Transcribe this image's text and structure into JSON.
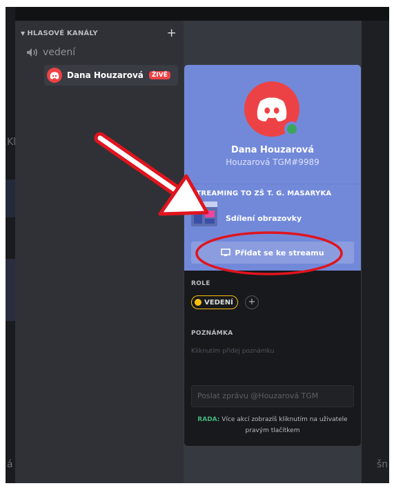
{
  "sidebar": {
    "category": "HLASOVÉ KANÁLY",
    "add_symbol": "+",
    "voice_channel": "vedení",
    "voice_user": {
      "name": "Dana Houzarová",
      "live_badge": "ŽIVĚ"
    }
  },
  "popout": {
    "name": "Dana Houzarová",
    "tag": "Houzarová TGM#9989",
    "stream_title": "STREAMING TO ZŠ T. G. MASARYKA",
    "stream_label": "Sdílení obrazovky",
    "join_button": "Přidat se ke streamu",
    "roles_title": "ROLE",
    "role": "VEDENÍ",
    "role_add": "+",
    "note_title": "POZNÁMKA",
    "note_placeholder": "Kliknutím přidej poznámku",
    "message_placeholder": "Poslat zprávu @Houzarová TGM",
    "tip_key": "RADA:",
    "tip_text": "Více akcí zobrazíš kliknutím na uživatele pravým tlačítkem"
  },
  "edge_texts": [
    "Kl",
    "á",
    "šn"
  ],
  "colors": {
    "blurple": "#7289da",
    "danger": "#ed4245",
    "online": "#3ba55c",
    "role": "#fcc10f",
    "annotation": "#e0141e"
  }
}
